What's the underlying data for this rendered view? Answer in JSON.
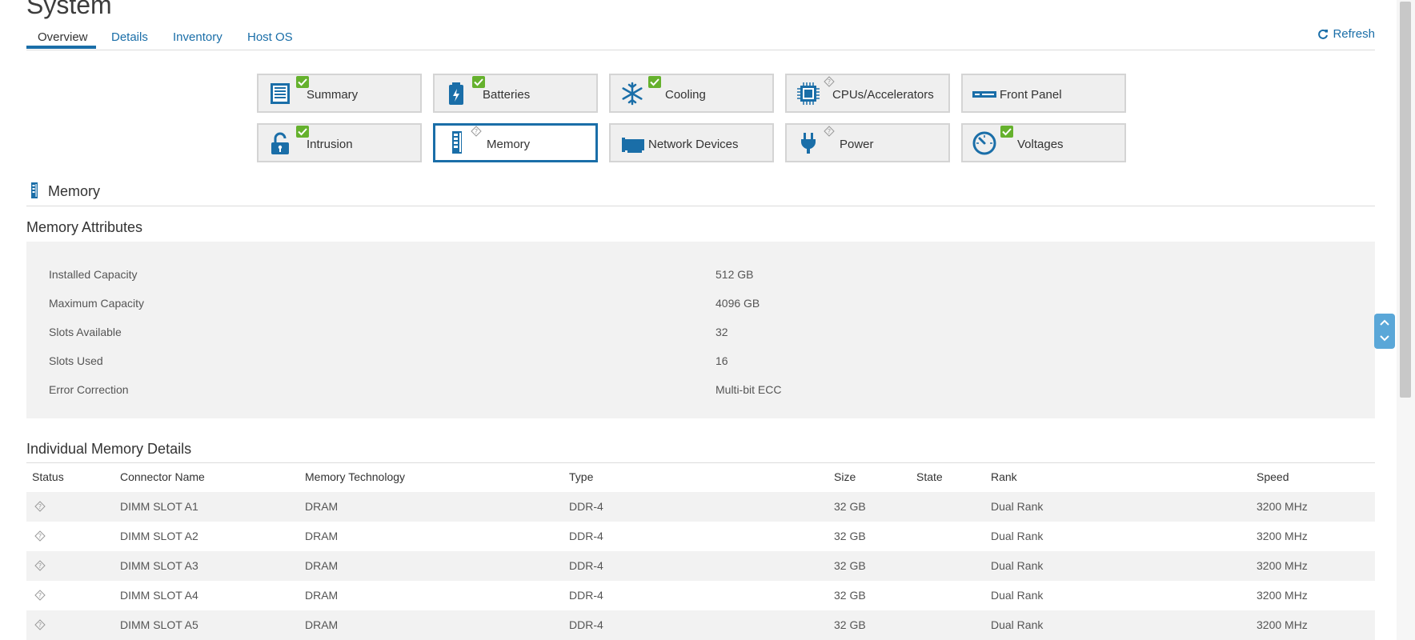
{
  "page": {
    "title": "System"
  },
  "tabs": [
    {
      "label": "Overview"
    },
    {
      "label": "Details"
    },
    {
      "label": "Inventory"
    },
    {
      "label": "Host OS"
    }
  ],
  "refresh_label": "Refresh",
  "tiles": [
    {
      "label": "Summary",
      "icon": "summary-icon",
      "status": "ok"
    },
    {
      "label": "Batteries",
      "icon": "battery-icon",
      "status": "ok"
    },
    {
      "label": "Cooling",
      "icon": "snowflake-icon",
      "status": "ok"
    },
    {
      "label": "CPUs/Accelerators",
      "icon": "cpu-icon",
      "status": "unknown"
    },
    {
      "label": "Front Panel",
      "icon": "front-panel-icon",
      "status": "none"
    },
    {
      "label": "Intrusion",
      "icon": "lock-open-icon",
      "status": "ok"
    },
    {
      "label": "Memory",
      "icon": "memory-icon",
      "status": "unknown",
      "selected": true
    },
    {
      "label": "Network Devices",
      "icon": "network-card-icon",
      "status": "none"
    },
    {
      "label": "Power",
      "icon": "power-plug-icon",
      "status": "unknown"
    },
    {
      "label": "Voltages",
      "icon": "gauge-icon",
      "status": "ok"
    }
  ],
  "memory_section": {
    "title": "Memory",
    "attributes_title": "Memory Attributes",
    "attributes": [
      {
        "label": "Installed Capacity",
        "value": "512 GB"
      },
      {
        "label": "Maximum Capacity",
        "value": "4096 GB"
      },
      {
        "label": "Slots Available",
        "value": "32"
      },
      {
        "label": "Slots Used",
        "value": "16"
      },
      {
        "label": "Error Correction",
        "value": "Multi-bit ECC"
      }
    ],
    "details_title": "Individual Memory Details",
    "columns": [
      "Status",
      "Connector Name",
      "Memory Technology",
      "Type",
      "Size",
      "State",
      "Rank",
      "Speed"
    ],
    "rows": [
      {
        "status": "unknown",
        "connector": "DIMM SLOT A1",
        "technology": "DRAM",
        "type": "DDR-4",
        "size": "32 GB",
        "state": "",
        "rank": "Dual Rank",
        "speed": "3200 MHz"
      },
      {
        "status": "unknown",
        "connector": "DIMM SLOT A2",
        "technology": "DRAM",
        "type": "DDR-4",
        "size": "32 GB",
        "state": "",
        "rank": "Dual Rank",
        "speed": "3200 MHz"
      },
      {
        "status": "unknown",
        "connector": "DIMM SLOT A3",
        "technology": "DRAM",
        "type": "DDR-4",
        "size": "32 GB",
        "state": "",
        "rank": "Dual Rank",
        "speed": "3200 MHz"
      },
      {
        "status": "unknown",
        "connector": "DIMM SLOT A4",
        "technology": "DRAM",
        "type": "DDR-4",
        "size": "32 GB",
        "state": "",
        "rank": "Dual Rank",
        "speed": "3200 MHz"
      },
      {
        "status": "unknown",
        "connector": "DIMM SLOT A5",
        "technology": "DRAM",
        "type": "DDR-4",
        "size": "32 GB",
        "state": "",
        "rank": "Dual Rank",
        "speed": "3200 MHz"
      }
    ]
  },
  "colors": {
    "accent": "#1a6ea8",
    "ok": "#65b12d",
    "panel": "#f2f2f2"
  }
}
